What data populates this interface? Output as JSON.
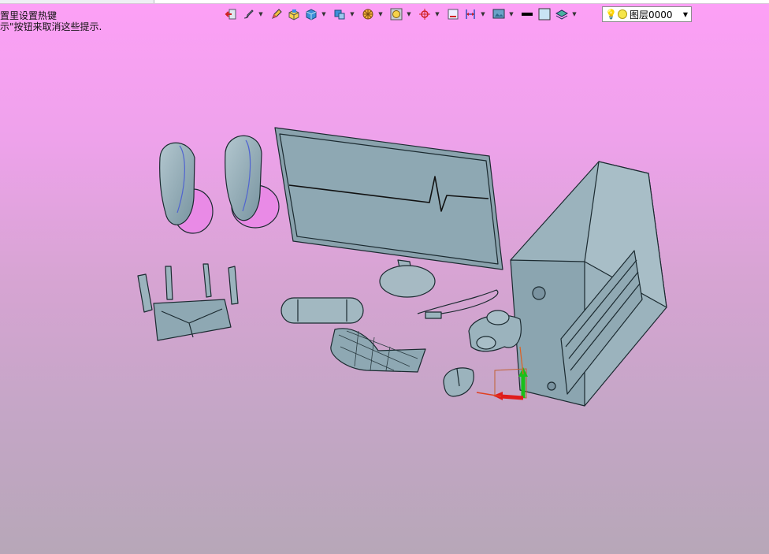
{
  "hint": {
    "line1": "置里设置热键",
    "line2": "示\"按钮来取消这些提示."
  },
  "toolbar": {
    "icons": [
      "exit-icon",
      "brush-icon",
      "pencil-icon",
      "box-icon",
      "cube-icon",
      "view-cube-icon",
      "wheel-icon",
      "frame-icon",
      "snap-target-icon",
      "ortho-icon",
      "measure-icon",
      "render-icon",
      "line-color-swatch",
      "fill-color-swatch",
      "layers-icon"
    ],
    "layer": {
      "icon_bulb": "bulb-icon",
      "icon_state": "sun-icon",
      "value": "图层0000"
    }
  },
  "colors": {
    "bg_top": "#fda0f6",
    "bg_bottom": "#b7a7b8",
    "model": "#8fa9b4",
    "edge": "#1b2a30",
    "speaker_pink": "#e98ae6"
  },
  "scene_objects": [
    "speakers",
    "monitor",
    "pc-tower",
    "router",
    "bluetooth-speaker",
    "usb-cable",
    "keyboard-mat",
    "game-controller",
    "mouse",
    "axis-triad"
  ]
}
